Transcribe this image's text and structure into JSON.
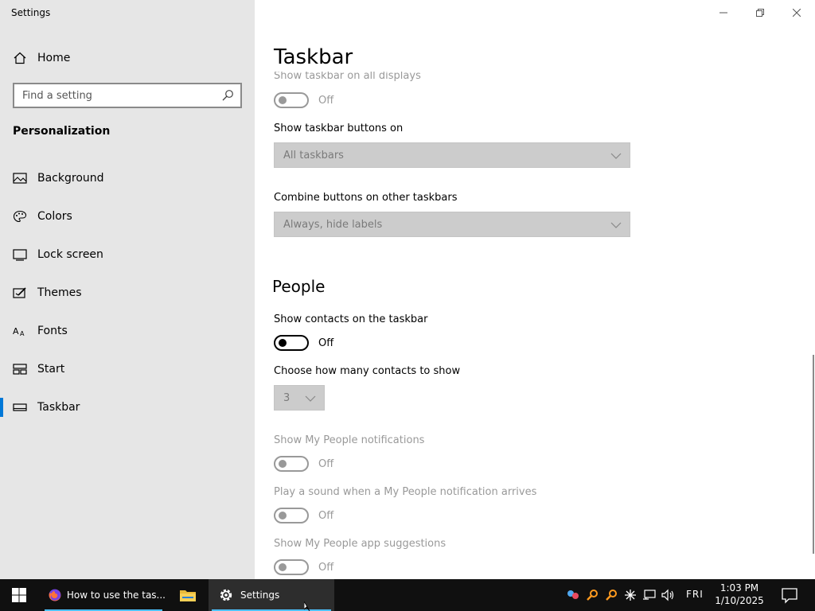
{
  "window": {
    "title": "Settings"
  },
  "sidebar": {
    "home_label": "Home",
    "search_placeholder": "Find a setting",
    "section_title": "Personalization",
    "items": [
      {
        "label": "Background",
        "icon": "picture-icon"
      },
      {
        "label": "Colors",
        "icon": "palette-icon"
      },
      {
        "label": "Lock screen",
        "icon": "lock-screen-icon"
      },
      {
        "label": "Themes",
        "icon": "themes-icon"
      },
      {
        "label": "Fonts",
        "icon": "fonts-icon"
      },
      {
        "label": "Start",
        "icon": "start-icon"
      },
      {
        "label": "Taskbar",
        "icon": "taskbar-icon",
        "selected": true
      }
    ]
  },
  "main": {
    "title": "Taskbar",
    "show_all_displays": {
      "label": "Show taskbar on all displays",
      "state": "Off"
    },
    "buttons_on": {
      "label": "Show taskbar buttons on",
      "value": "All taskbars"
    },
    "combine_other": {
      "label": "Combine buttons on other taskbars",
      "value": "Always, hide labels"
    },
    "people": {
      "heading": "People",
      "show_contacts": {
        "label": "Show contacts on the taskbar",
        "state": "Off"
      },
      "contacts_count": {
        "label": "Choose how many contacts to show",
        "value": "3"
      },
      "notifications": {
        "label": "Show My People notifications",
        "state": "Off"
      },
      "sound": {
        "label": "Play a sound when a My People notification arrives",
        "state": "Off"
      },
      "suggestions": {
        "label": "Show My People app suggestions",
        "state": "Off"
      }
    }
  },
  "taskbar": {
    "apps": [
      {
        "label": "How to use the tas...",
        "icon": "firefox-icon"
      },
      {
        "label": "",
        "icon": "file-explorer-icon"
      },
      {
        "label": "Settings",
        "icon": "gear-icon"
      }
    ],
    "day": "FRI",
    "time": "1:03 PM",
    "date": "1/10/2025"
  },
  "colors": {
    "accent": "#0078d7",
    "sidebar_bg": "#e6e6e6",
    "taskbar_bg": "#101010"
  }
}
